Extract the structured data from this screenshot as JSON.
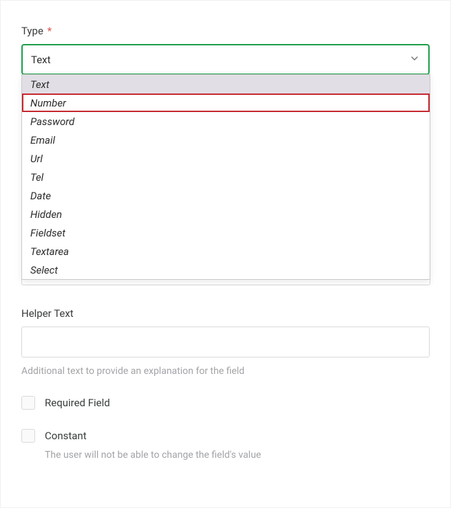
{
  "type_field": {
    "label": "Type",
    "required_marker": "*",
    "selected_value": "Text",
    "options": [
      "Text",
      "Number",
      "Password",
      "Email",
      "Url",
      "Tel",
      "Date",
      "Hidden",
      "Fieldset",
      "Textarea",
      "Select"
    ],
    "selected_index": 0,
    "highlighted_index": 1
  },
  "helper_text_field": {
    "label": "Helper Text",
    "value": "",
    "caption": "Additional text to provide an explanation for the field"
  },
  "required_field_checkbox": {
    "label": "Required Field",
    "checked": false
  },
  "constant_checkbox": {
    "label": "Constant",
    "checked": false,
    "description": "The user will not be able to change the field's value"
  }
}
